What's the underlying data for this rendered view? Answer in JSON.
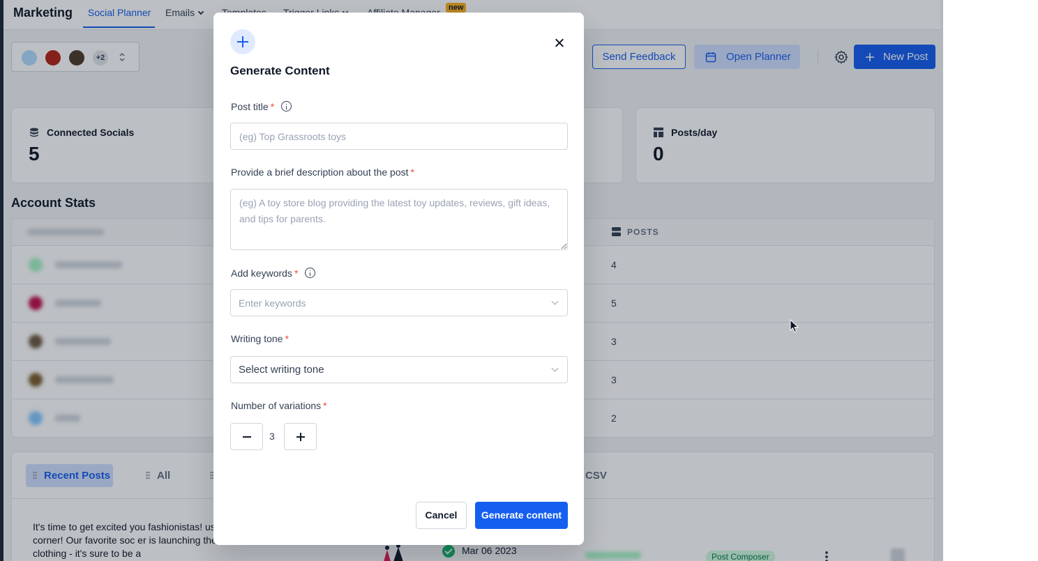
{
  "nav": {
    "brand": "Marketing",
    "tabs": [
      "Social Planner",
      "Emails",
      "Templates",
      "Trigger Links",
      "Affiliate Manager"
    ],
    "new_badge": "new"
  },
  "accounts": {
    "more_count": "+2"
  },
  "header_buttons": {
    "feedback": "Send Feedback",
    "planner": "Open Planner",
    "new_post": "New Post"
  },
  "stats": {
    "connected_label": "Connected Socials",
    "connected_value": "5",
    "posts_day_label": "Posts/day",
    "posts_day_value": "0"
  },
  "account_stats": {
    "title": "Account Stats",
    "posts_header": "POSTS",
    "post_counts": [
      "4",
      "5",
      "3",
      "3",
      "2"
    ]
  },
  "recent_posts": {
    "tab_recent": "Recent Posts",
    "tab_all": "All",
    "tab_csv": "CSV",
    "snippet": "It's time to get excited you fashionistas! ust around the corner! Our favorite soc er is launching their own line of clothing - it's sure to be a",
    "date": "Mar 06 2023",
    "badge": "Post Composer"
  },
  "modal": {
    "title": "Generate Content",
    "post_title_label": "Post title",
    "post_title_placeholder": "(eg) Top Grassroots toys",
    "description_label": "Provide a brief description about the post",
    "description_placeholder": "(eg) A toy store blog providing the latest toy updates, reviews, gift ideas, and tips for parents.",
    "keywords_label": "Add keywords",
    "keywords_placeholder": "Enter keywords",
    "tone_label": "Writing tone",
    "tone_value": "Select writing tone",
    "variations_label": "Number of variations",
    "variations_value": "3",
    "required_mark": "*",
    "cancel": "Cancel",
    "generate": "Generate content"
  },
  "colors": {
    "primary": "#155eef",
    "danger": "#f04438",
    "success": "#12b76a"
  }
}
